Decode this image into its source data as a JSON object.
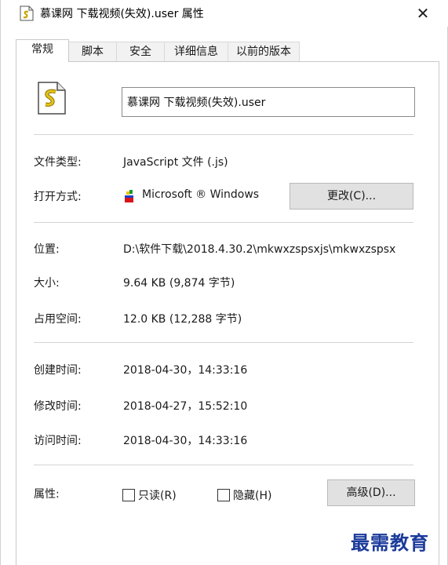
{
  "window": {
    "title": "慕课网 下载视频(失效).user 属性",
    "title_icon": "script-file-icon",
    "close_glyph": "✕"
  },
  "tabs": [
    {
      "label": "常规",
      "active": true
    },
    {
      "label": "脚本",
      "active": false
    },
    {
      "label": "安全",
      "active": false
    },
    {
      "label": "详细信息",
      "active": false
    },
    {
      "label": "以前的版本",
      "active": false
    }
  ],
  "general": {
    "file_icon": "javascript-file-icon",
    "filename_value": "慕课网 下载视频(失效).user",
    "type_label": "文件类型:",
    "type_value": "JavaScript 文件 (.js)",
    "opens_with_label": "打开方式:",
    "opens_with_icon": "windows-script-host-icon",
    "opens_with_value": "Microsoft ® Windows",
    "change_button": "更改(C)...",
    "location_label": "位置:",
    "location_value": "D:\\软件下载\\2018.4.30.2\\mkwxzspsxjs\\mkwxzspsx",
    "size_label": "大小:",
    "size_value": "9.64 KB (9,874 字节)",
    "size_on_disk_label": "占用空间:",
    "size_on_disk_value": "12.0 KB (12,288 字节)",
    "created_label": "创建时间:",
    "created_value": "2018-04-30，14:33:16",
    "modified_label": "修改时间:",
    "modified_value": "2018-04-27，15:52:10",
    "accessed_label": "访问时间:",
    "accessed_value": "2018-04-30，14:33:16",
    "attributes_label": "属性:",
    "readonly_label": "只读(R)",
    "readonly_checked": false,
    "hidden_label": "隐藏(H)",
    "hidden_checked": false,
    "advanced_button": "高级(D)..."
  },
  "watermark": "最需教育",
  "colors": {
    "watermark": "#1b3a9b",
    "button_bg": "#e1e1e1"
  }
}
